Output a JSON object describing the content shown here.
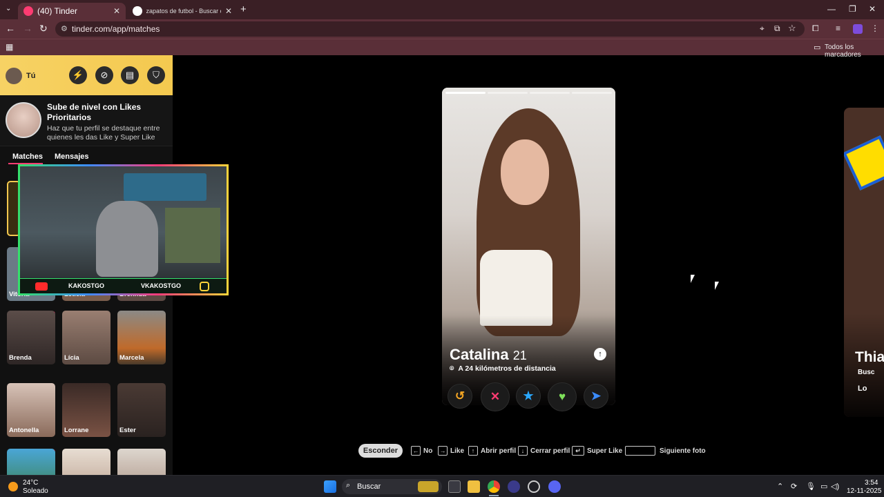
{
  "browser": {
    "tabs": [
      {
        "title": "(40) Tinder",
        "active": true
      },
      {
        "title": "zapatos de futbol - Buscar con",
        "active": false
      }
    ],
    "url": "tinder.com/app/matches",
    "bookmarks_label": "Todos los marcadores"
  },
  "sidebar": {
    "me_label": "Tú",
    "header_icons": [
      "boost-icon",
      "explore-icon",
      "briefcase-icon",
      "shield-icon"
    ],
    "promo": {
      "title": "Sube de nivel con Likes Prioritarios",
      "subtitle": "Haz que tu perfil se destaque entre quienes les das Like y Super Like"
    },
    "tabs": [
      "Matches",
      "Mensajes"
    ],
    "matches": [
      {
        "name": "Vitória",
        "new": false
      },
      {
        "name": "Letícia",
        "new": false
      },
      {
        "name": "Brennda",
        "new": false
      },
      {
        "name": "Brenda",
        "new": true
      },
      {
        "name": "Lícia",
        "new": false
      },
      {
        "name": "Marcela",
        "new": false
      },
      {
        "name": "Antonella",
        "new": false
      },
      {
        "name": "Lorrane",
        "new": false
      },
      {
        "name": "Ester",
        "new": false
      },
      {
        "name": "",
        "new": true
      },
      {
        "name": "",
        "new": false
      },
      {
        "name": "",
        "new": false
      }
    ]
  },
  "stream_overlay": {
    "left_handle": "KAKOSTGO",
    "right_handle": "VKAKOSTGO"
  },
  "profile": {
    "name": "Catalina",
    "age": "21",
    "distance": "A 24 kilómetros de distancia",
    "photo_count": 4,
    "active_photo": 1,
    "actions": [
      {
        "name": "rewind",
        "glyph": "↺",
        "color": "#f5a623"
      },
      {
        "name": "nope",
        "glyph": "✕",
        "color": "#fe3c72"
      },
      {
        "name": "superlike",
        "glyph": "★",
        "color": "#2aa8ff"
      },
      {
        "name": "like",
        "glyph": "♥",
        "color": "#7ee05a"
      },
      {
        "name": "boost",
        "glyph": "➤",
        "color": "#3b8cff"
      }
    ]
  },
  "next_profile": {
    "name_partial": "Thia",
    "line1": "Busc",
    "line2": "Lo"
  },
  "shortcuts": {
    "hide_label": "Esconder",
    "items": [
      "No",
      "Like",
      "Abrir perfil",
      "Cerrar perfil",
      "Super Like",
      "Siguiente foto"
    ]
  },
  "taskbar": {
    "weather_temp": "24°C",
    "weather_desc": "Soleado",
    "search_placeholder": "Buscar",
    "time": "3:54",
    "date": "12-11-2025"
  }
}
